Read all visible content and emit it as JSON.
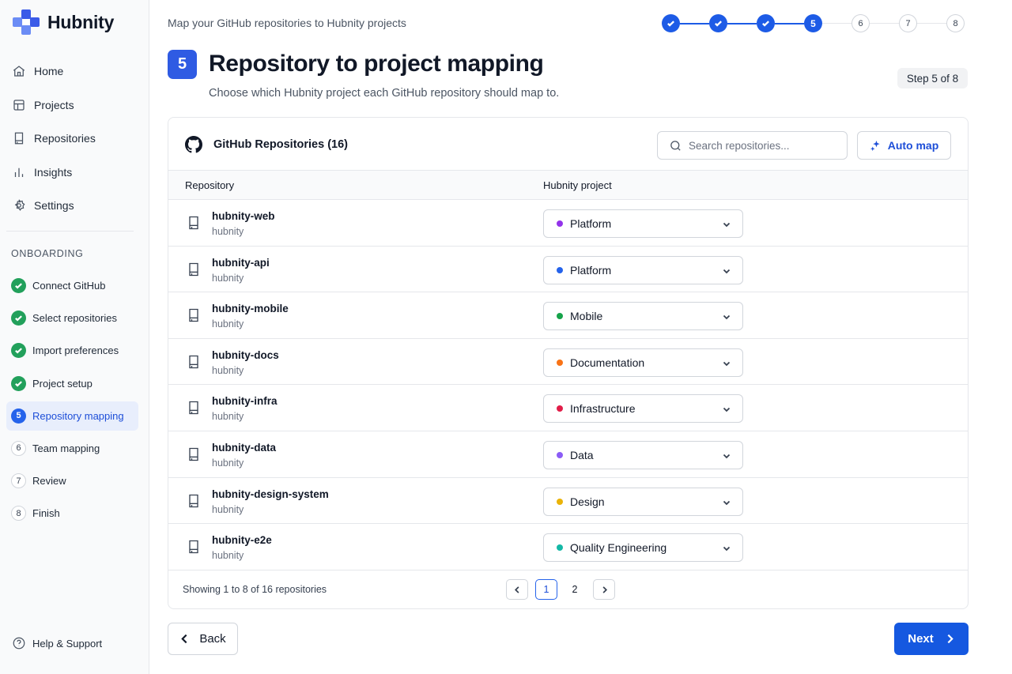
{
  "app": {
    "name": "Hubnity",
    "logo_icon": "hubnity-logo-icon",
    "brand_color": "#3b5be8"
  },
  "sidebar": {
    "nav": [
      {
        "label": "Home",
        "icon": "home-icon"
      },
      {
        "label": "Projects",
        "icon": "projects-icon"
      },
      {
        "label": "Repositories",
        "icon": "repository-icon"
      },
      {
        "label": "Insights",
        "icon": "bar-chart-icon"
      },
      {
        "label": "Settings",
        "icon": "gear-icon"
      }
    ],
    "section_label": "ONBOARDING",
    "steps": [
      {
        "label": "Connect GitHub",
        "status": "done"
      },
      {
        "label": "Select repositories",
        "status": "done"
      },
      {
        "label": "Import preferences",
        "status": "done"
      },
      {
        "label": "Project setup",
        "status": "done"
      },
      {
        "label": "Repository mapping",
        "status": "current",
        "number": "5"
      },
      {
        "label": "Team mapping",
        "status": "pending",
        "number": "6"
      },
      {
        "label": "Review",
        "status": "pending",
        "number": "7"
      },
      {
        "label": "Finish",
        "status": "pending",
        "number": "8"
      }
    ],
    "help_label": "Help & Support"
  },
  "header": {
    "subtitle": "Map your GitHub repositories to Hubnity projects",
    "progress": [
      {
        "status": "done"
      },
      {
        "status": "done"
      },
      {
        "status": "done"
      },
      {
        "status": "current",
        "number": "5"
      },
      {
        "status": "pending",
        "number": "6"
      },
      {
        "status": "pending",
        "number": "7"
      },
      {
        "status": "pending",
        "number": "8"
      }
    ],
    "step_number": "5",
    "title": "Repository to project mapping",
    "description": "Choose which Hubnity project each GitHub repository should map to.",
    "step_badge": "Step 5 of 8"
  },
  "card": {
    "title": "GitHub Repositories (16)",
    "search_placeholder": "Search repositories...",
    "automap_label": "Auto map",
    "columns": {
      "repository": "Repository",
      "project": "Hubnity project"
    },
    "rows": [
      {
        "name": "hubnity-web",
        "owner": "hubnity",
        "project": "Platform",
        "color": "#9333ea"
      },
      {
        "name": "hubnity-api",
        "owner": "hubnity",
        "project": "Platform",
        "color": "#2563eb"
      },
      {
        "name": "hubnity-mobile",
        "owner": "hubnity",
        "project": "Mobile",
        "color": "#16a34a"
      },
      {
        "name": "hubnity-docs",
        "owner": "hubnity",
        "project": "Documentation",
        "color": "#f97316"
      },
      {
        "name": "hubnity-infra",
        "owner": "hubnity",
        "project": "Infrastructure",
        "color": "#e11d48"
      },
      {
        "name": "hubnity-data",
        "owner": "hubnity",
        "project": "Data",
        "color": "#8b5cf6"
      },
      {
        "name": "hubnity-design-system",
        "owner": "hubnity",
        "project": "Design",
        "color": "#eab308"
      },
      {
        "name": "hubnity-e2e",
        "owner": "hubnity",
        "project": "Quality Engineering",
        "color": "#14b8a6"
      }
    ],
    "footer": {
      "showing": "Showing 1 to 8 of 16 repositories",
      "pages": [
        "1",
        "2"
      ],
      "current_page": "1"
    }
  },
  "actions": {
    "back_label": "Back",
    "next_label": "Next"
  }
}
